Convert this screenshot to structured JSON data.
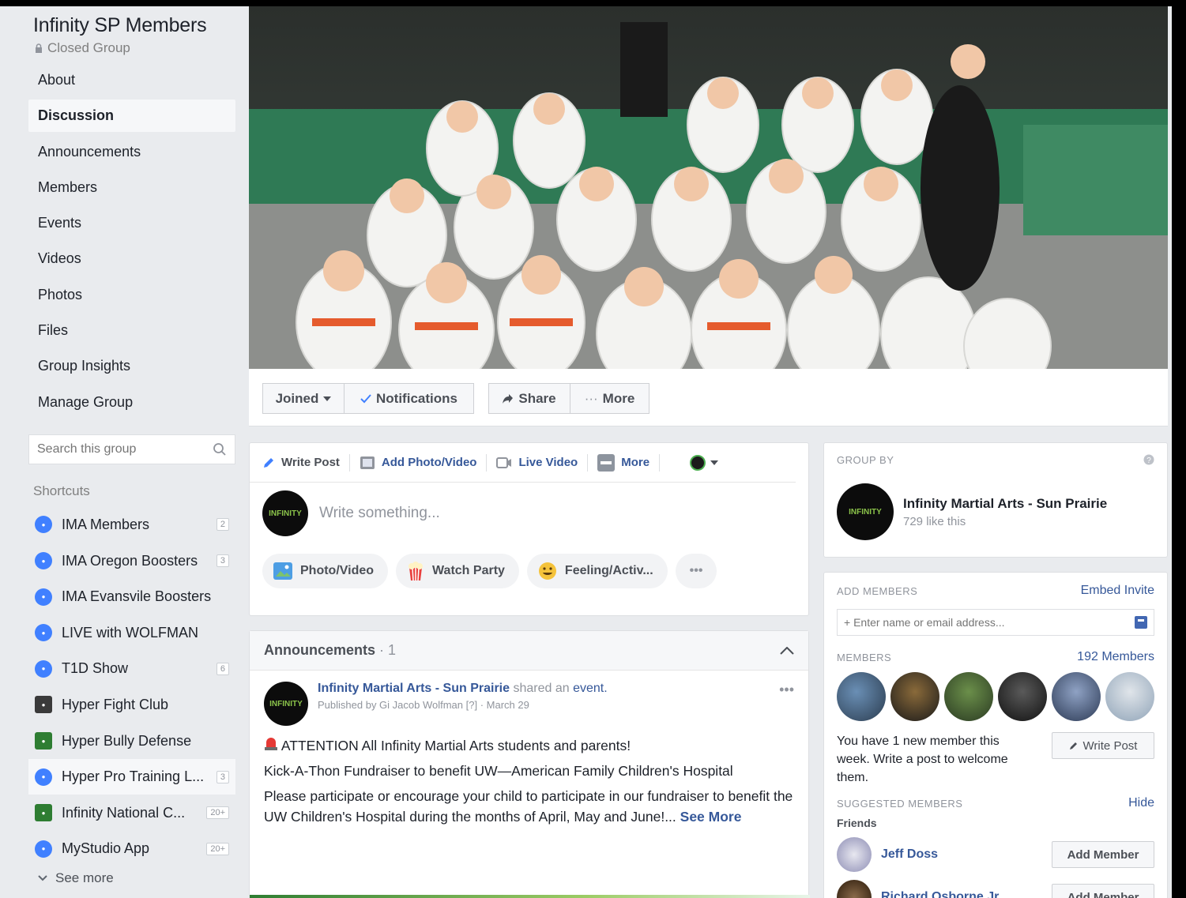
{
  "colors": {
    "background": "#e9ebee",
    "link": "#365899",
    "accent": "#4080ff",
    "text": "#1d2129",
    "muted": "#90949c"
  },
  "group": {
    "name": "Infinity SP Members",
    "privacy": "Closed Group",
    "privacy_icon": "lock-icon"
  },
  "nav": {
    "items": [
      {
        "label": "About"
      },
      {
        "label": "Discussion"
      },
      {
        "label": "Announcements"
      },
      {
        "label": "Members"
      },
      {
        "label": "Events"
      },
      {
        "label": "Videos"
      },
      {
        "label": "Photos"
      },
      {
        "label": "Files"
      },
      {
        "label": "Group Insights"
      },
      {
        "label": "Manage Group"
      }
    ],
    "active": "Discussion"
  },
  "search": {
    "placeholder": "Search this group"
  },
  "shortcuts": {
    "label": "Shortcuts",
    "items": [
      {
        "label": "IMA Members",
        "badge": "2"
      },
      {
        "label": "IMA Oregon Boosters",
        "badge": "3"
      },
      {
        "label": "IMA Evansvile Boosters",
        "badge": ""
      },
      {
        "label": "LIVE with WOLFMAN",
        "badge": ""
      },
      {
        "label": "T1D Show",
        "badge": "6"
      },
      {
        "label": "Hyper Fight Club",
        "badge": ""
      },
      {
        "label": "Hyper Bully Defense",
        "badge": ""
      },
      {
        "label": "Hyper Pro Training L...",
        "badge": "3"
      },
      {
        "label": "Infinity National C...",
        "badge": "20+"
      },
      {
        "label": "MyStudio App",
        "badge": "20+"
      }
    ],
    "see_more": "See more"
  },
  "actions": {
    "joined": "Joined",
    "notifications": "Notifications",
    "share": "Share",
    "more": "More"
  },
  "composer": {
    "tabs": [
      "Write Post",
      "Add Photo/Video",
      "Live Video",
      "More"
    ],
    "placeholder": "Write something...",
    "pills": [
      "Photo/Video",
      "Watch Party",
      "Feeling/Activ..."
    ],
    "pill_more": "•••",
    "avatar_text": "INFINITY"
  },
  "announcements": {
    "title": "Announcements",
    "count": "· 1",
    "post": {
      "author": "Infinity Martial Arts - Sun Prairie",
      "action": "shared an",
      "object": "event.",
      "published": "Published by Gi Jacob Wolfman [?] · March 29",
      "line1": "ATTENTION All Infinity Martial Arts students and parents!",
      "line2": "Kick-A-Thon Fundraiser to benefit UW—American Family Children's Hospital",
      "line3": "Please participate or encourage your child to participate in our fundraiser to benefit the UW Children's Hospital during the months of April, May and June!...",
      "see_more": "See More"
    }
  },
  "group_by": {
    "label": "GROUP BY",
    "page_name": "Infinity Martial Arts - Sun Prairie",
    "likes": "729 like this"
  },
  "add_members": {
    "label": "ADD MEMBERS",
    "embed": "Embed Invite",
    "input_placeholder": "+ Enter name or email address...",
    "members_label": "MEMBERS",
    "members_count": "192 Members",
    "new_member_text": "You have 1 new member this week. Write a post to welcome them.",
    "write_post": "Write Post",
    "suggested_label": "SUGGESTED MEMBERS",
    "hide": "Hide",
    "friends_label": "Friends",
    "suggested": [
      {
        "name": "Jeff Doss",
        "button": "Add Member"
      },
      {
        "name": "Richard Osborne Jr.",
        "button": "Add Member"
      }
    ]
  }
}
